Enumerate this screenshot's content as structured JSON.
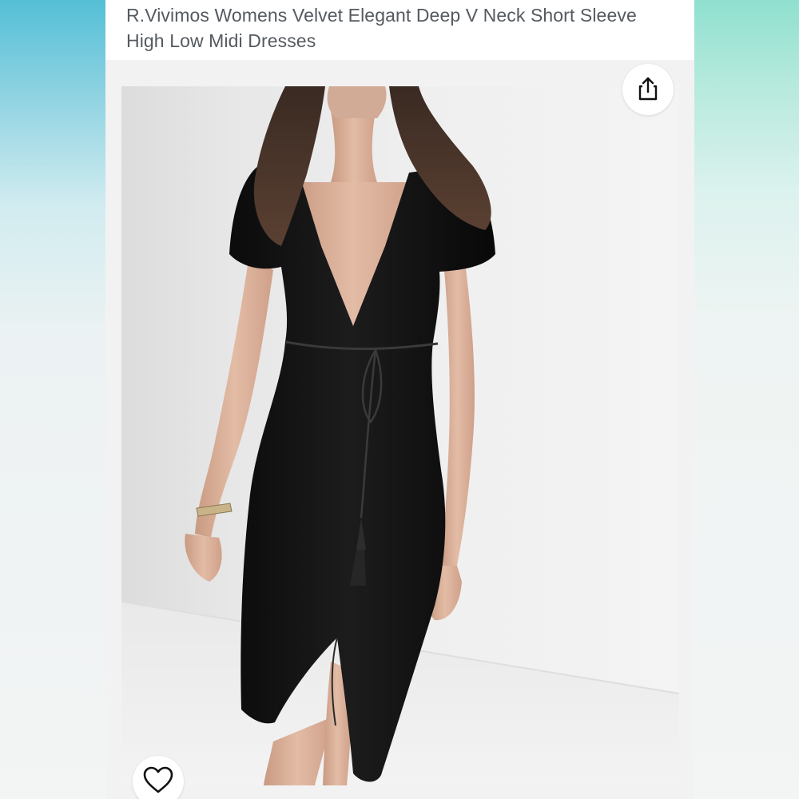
{
  "product": {
    "title": "R.Vivimos Womens Velvet Elegant Deep V Neck Short Sleeve High Low Midi Dresses"
  },
  "image": {
    "subject": "model wearing black velvet deep V-neck wrap midi dress with tie belt"
  },
  "actions": {
    "share_icon": "share-icon",
    "favorite_icon": "heart-outline-icon"
  },
  "colors": {
    "title_text": "#555a60",
    "dress": "#111111",
    "card_background": "#f2f2f2",
    "top_gradient": "#69c3d7"
  }
}
